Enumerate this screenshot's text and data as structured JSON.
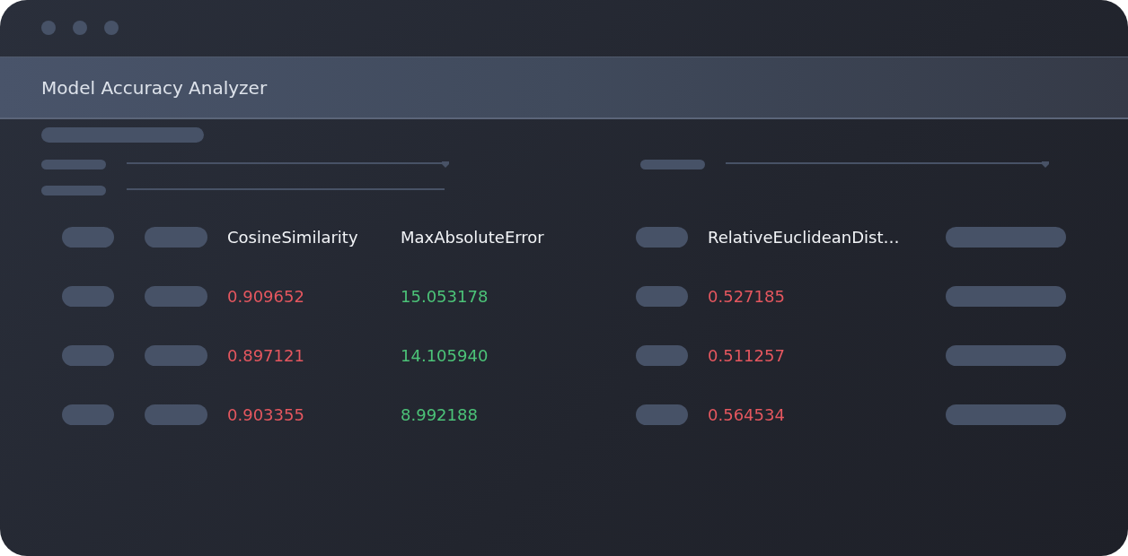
{
  "window": {
    "title": "Model Accuracy Analyzer"
  },
  "table": {
    "columns": [
      "CosineSimilarity",
      "MaxAbsoluteError",
      "RelativeEuclideanDist…"
    ],
    "rows": [
      {
        "cells": [
          {
            "text": "0.909652",
            "color": "#e5575f"
          },
          {
            "text": "15.053178",
            "color": "#4cc378"
          },
          {
            "text": "0.527185",
            "color": "#e5575f"
          }
        ]
      },
      {
        "cells": [
          {
            "text": "0.897121",
            "color": "#e5575f"
          },
          {
            "text": "14.105940",
            "color": "#4cc378"
          },
          {
            "text": "0.511257",
            "color": "#e5575f"
          }
        ]
      },
      {
        "cells": [
          {
            "text": "0.903355",
            "color": "#e5575f"
          },
          {
            "text": "8.992188",
            "color": "#4cc378"
          },
          {
            "text": "0.564534",
            "color": "#e5575f"
          }
        ]
      }
    ]
  }
}
